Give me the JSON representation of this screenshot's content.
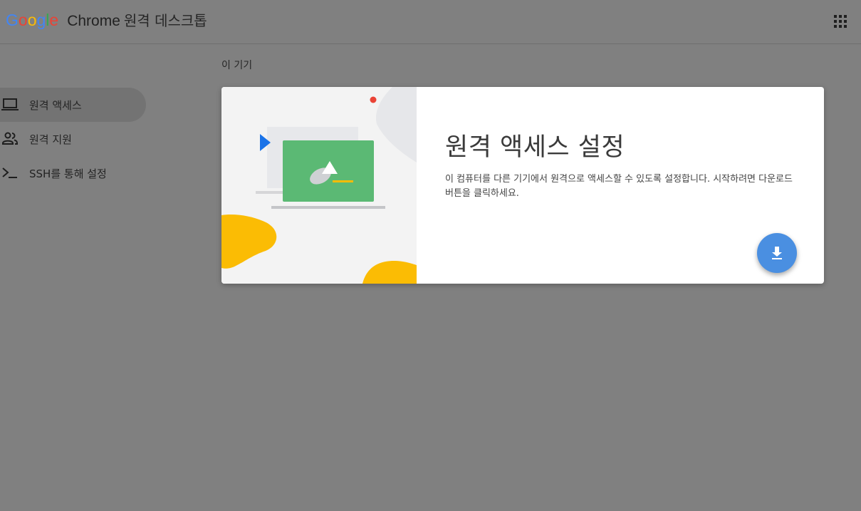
{
  "header": {
    "logo_letters": [
      "G",
      "o",
      "o",
      "g",
      "l",
      "e"
    ],
    "logo_colors": [
      "#4285f4",
      "#ea4335",
      "#fbbc05",
      "#4285f4",
      "#34a853",
      "#ea4335"
    ],
    "product": "Chrome",
    "title": "원격 데스크톱",
    "apps_icon": "apps-grid-icon"
  },
  "sidebar": {
    "items": [
      {
        "label": "원격 액세스",
        "icon": "laptop-icon",
        "active": true
      },
      {
        "label": "원격 지원",
        "icon": "people-icon",
        "active": false
      },
      {
        "label": "SSH를 통해 설정",
        "icon": "terminal-icon",
        "active": false
      }
    ]
  },
  "main": {
    "section_title": "이 기기",
    "card": {
      "heading": "원격 액세스 설정",
      "description": "이 컴퓨터를 다른 기기에서 원격으로 액세스할 수 있도록 설정합니다. 시작하려면 다운로드 버튼을 클릭하세요.",
      "download_icon": "download-icon"
    }
  },
  "colors": {
    "accent": "#4a8fe1",
    "overlay_bg": "#808080",
    "illustration_green": "#5bb974",
    "illustration_yellow": "#fbbc04",
    "illustration_red": "#ea4335",
    "illustration_blue": "#1a73e8"
  }
}
